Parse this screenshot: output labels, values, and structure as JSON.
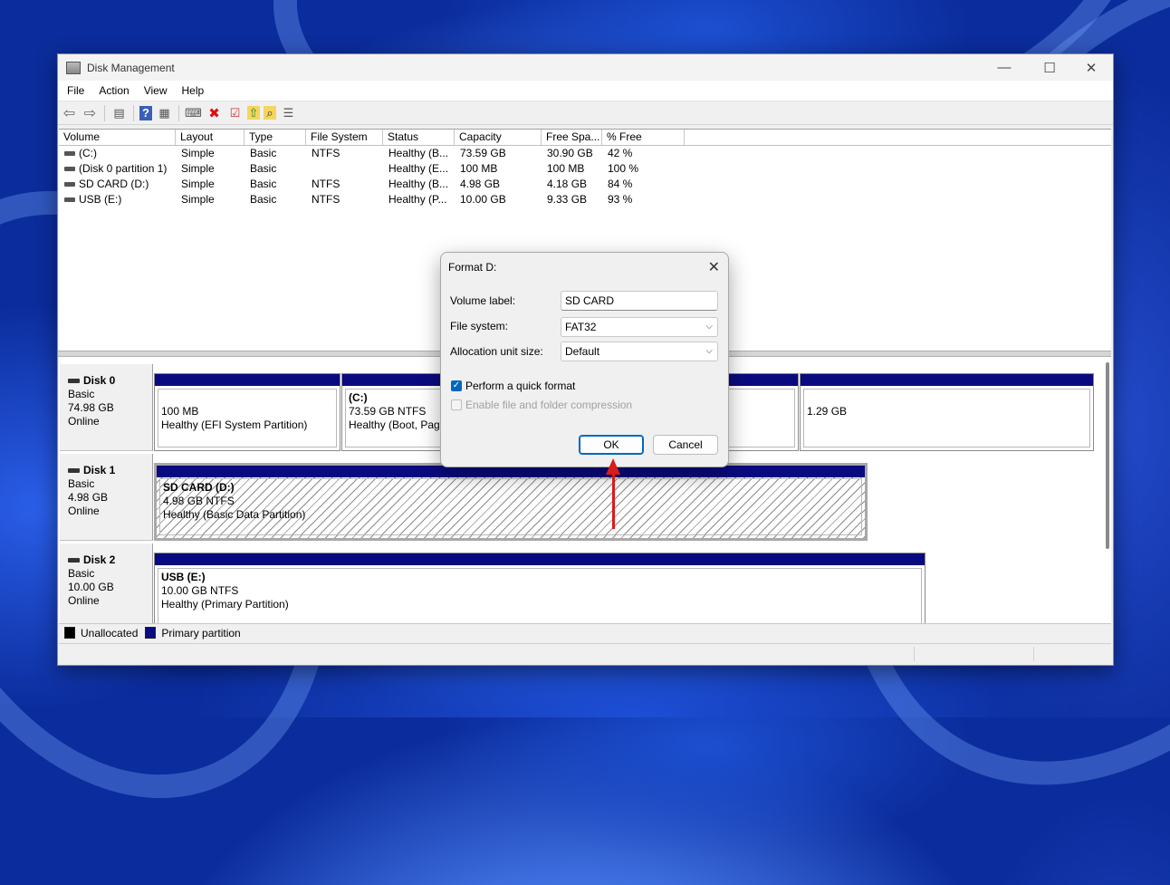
{
  "window": {
    "title": "Disk Management",
    "controls": {
      "minimize": "—",
      "maximize": "☐",
      "close": "✕"
    }
  },
  "menu": [
    "File",
    "Action",
    "View",
    "Help"
  ],
  "toolbar": [
    {
      "name": "back-icon",
      "glyph": "⇦"
    },
    {
      "name": "forward-icon",
      "glyph": "⇨"
    },
    {
      "name": "console-tree-icon",
      "glyph": "▤"
    },
    {
      "name": "help-icon",
      "glyph": "?"
    },
    {
      "name": "properties-icon",
      "glyph": "▦"
    },
    {
      "name": "connect-icon",
      "glyph": "⌨"
    },
    {
      "name": "delete-icon",
      "glyph": "✖"
    },
    {
      "name": "check-icon",
      "glyph": "☑"
    },
    {
      "name": "folder-up-icon",
      "glyph": "⇧"
    },
    {
      "name": "search-folder-icon",
      "glyph": "⌕"
    },
    {
      "name": "settings-list-icon",
      "glyph": "☰"
    }
  ],
  "volume_list": {
    "columns": [
      "Volume",
      "Layout",
      "Type",
      "File System",
      "Status",
      "Capacity",
      "Free Spa...",
      "% Free"
    ],
    "rows": [
      [
        "(C:)",
        "Simple",
        "Basic",
        "NTFS",
        "Healthy (B...",
        "73.59 GB",
        "30.90 GB",
        "42 %"
      ],
      [
        "(Disk 0 partition 1)",
        "Simple",
        "Basic",
        "",
        "Healthy (E...",
        "100 MB",
        "100 MB",
        "100 %"
      ],
      [
        "SD CARD (D:)",
        "Simple",
        "Basic",
        "NTFS",
        "Healthy (B...",
        "4.98 GB",
        "4.18 GB",
        "84 %"
      ],
      [
        "USB (E:)",
        "Simple",
        "Basic",
        "NTFS",
        "Healthy (P...",
        "10.00 GB",
        "9.33 GB",
        "93 %"
      ]
    ]
  },
  "disks": [
    {
      "name": "Disk 0",
      "type": "Basic",
      "size": "74.98 GB",
      "state": "Online",
      "partitions": [
        {
          "title": "",
          "size": "100 MB",
          "status": "Healthy (EFI System Partition)"
        },
        {
          "title": "(C:)",
          "size": "73.59 GB NTFS",
          "status": "Healthy (Boot, Page"
        },
        {
          "title": "",
          "size": "1.29 GB",
          "status": ""
        }
      ]
    },
    {
      "name": "Disk 1",
      "type": "Basic",
      "size": "4.98 GB",
      "state": "Online",
      "partitions": [
        {
          "title": "SD CARD  (D:)",
          "size": "4.98 GB NTFS",
          "status": "Healthy (Basic Data Partition)"
        }
      ]
    },
    {
      "name": "Disk 2",
      "type": "Basic",
      "size": "10.00 GB",
      "state": "Online",
      "partitions": [
        {
          "title": "USB  (E:)",
          "size": "10.00 GB NTFS",
          "status": "Healthy (Primary Partition)"
        }
      ]
    }
  ],
  "legend": [
    {
      "label": "Unallocated",
      "color": "#000000"
    },
    {
      "label": "Primary partition",
      "color": "#0a0a80"
    }
  ],
  "dialog": {
    "title": "Format D:",
    "close": "✕",
    "volume_label": {
      "label": "Volume label:",
      "value": "SD CARD"
    },
    "file_system": {
      "label": "File system:",
      "value": "FAT32"
    },
    "allocation": {
      "label": "Allocation unit size:",
      "value": "Default"
    },
    "quick_format": {
      "label": "Perform a quick format",
      "checked": true
    },
    "compression": {
      "label": "Enable file and folder compression",
      "checked": false
    },
    "ok": "OK",
    "cancel": "Cancel"
  },
  "annotation_color": "#d81b1b"
}
